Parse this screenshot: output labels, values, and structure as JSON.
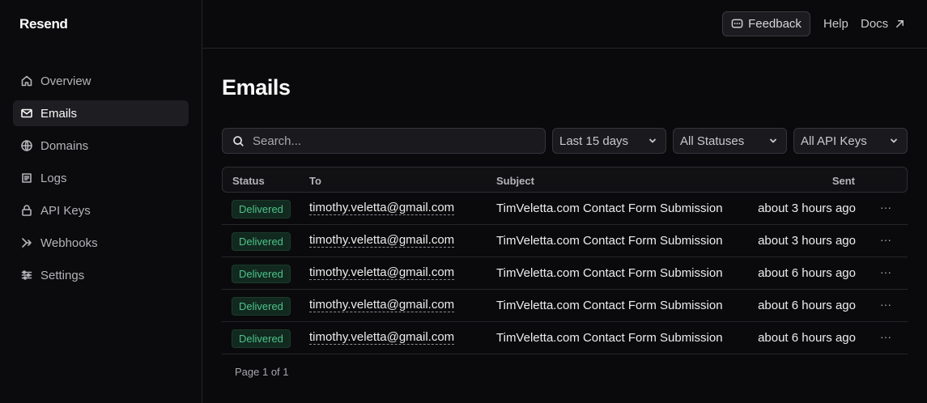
{
  "app": {
    "logo": "Resend"
  },
  "sidebar": {
    "items": [
      {
        "label": "Overview",
        "icon": "home-icon"
      },
      {
        "label": "Emails",
        "icon": "mail-icon",
        "active": true
      },
      {
        "label": "Domains",
        "icon": "globe-icon"
      },
      {
        "label": "Logs",
        "icon": "list-icon"
      },
      {
        "label": "API Keys",
        "icon": "lock-icon"
      },
      {
        "label": "Webhooks",
        "icon": "webhook-icon"
      },
      {
        "label": "Settings",
        "icon": "sliders-icon"
      }
    ]
  },
  "topbar": {
    "feedback": "Feedback",
    "help": "Help",
    "docs": "Docs"
  },
  "page": {
    "title": "Emails"
  },
  "filters": {
    "search_placeholder": "Search...",
    "date_range": "Last 15 days",
    "status": "All Statuses",
    "api_keys": "All API Keys"
  },
  "table": {
    "columns": {
      "status": "Status",
      "to": "To",
      "subject": "Subject",
      "sent": "Sent"
    },
    "rows": [
      {
        "status": "Delivered",
        "to": "timothy.veletta@gmail.com",
        "subject": "TimVeletta.com Contact Form Submission",
        "sent": "about 3 hours ago",
        "more": "···"
      },
      {
        "status": "Delivered",
        "to": "timothy.veletta@gmail.com",
        "subject": "TimVeletta.com Contact Form Submission",
        "sent": "about 3 hours ago",
        "more": "···"
      },
      {
        "status": "Delivered",
        "to": "timothy.veletta@gmail.com",
        "subject": "TimVeletta.com Contact Form Submission",
        "sent": "about 6 hours ago",
        "more": "···"
      },
      {
        "status": "Delivered",
        "to": "timothy.veletta@gmail.com",
        "subject": "TimVeletta.com Contact Form Submission",
        "sent": "about 6 hours ago",
        "more": "···"
      },
      {
        "status": "Delivered",
        "to": "timothy.veletta@gmail.com",
        "subject": "TimVeletta.com Contact Form Submission",
        "sent": "about 6 hours ago",
        "more": "···"
      }
    ]
  },
  "pagination": {
    "label": "Page 1 of 1"
  },
  "colors": {
    "background": "#0a0a0c",
    "delivered": "#4cc38a",
    "delivered_bg": "#12291f"
  }
}
